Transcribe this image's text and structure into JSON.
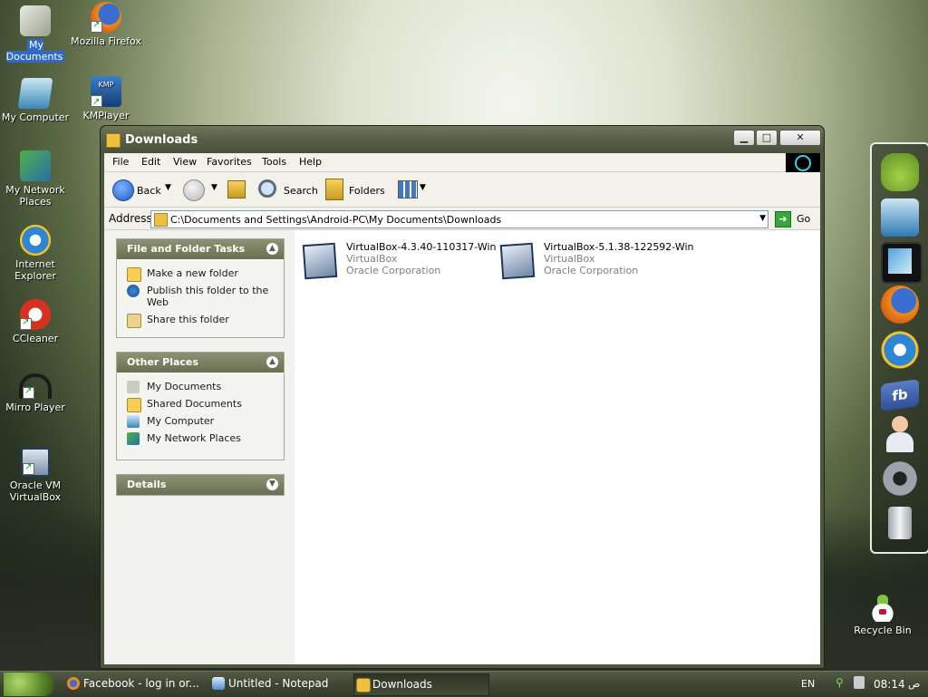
{
  "desktop": {
    "icons": [
      {
        "label": "My Documents"
      },
      {
        "label": "Mozilla Firefox"
      },
      {
        "label": "My Computer"
      },
      {
        "label": "KMPlayer",
        "badge": "KMP"
      },
      {
        "label": "My Network Places"
      },
      {
        "label": "Internet Explorer"
      },
      {
        "label": "CCleaner"
      },
      {
        "label": "Mirro Player"
      },
      {
        "label": "Oracle VM VirtualBox"
      },
      {
        "label": "Recycle Bin"
      }
    ]
  },
  "window": {
    "title": "Downloads",
    "menu": [
      "File",
      "Edit",
      "View",
      "Favorites",
      "Tools",
      "Help"
    ],
    "toolbar": {
      "back": "Back",
      "search": "Search",
      "folders": "Folders"
    },
    "address": {
      "label": "Address",
      "value": "C:\\Documents and Settings\\Android-PC\\My Documents\\Downloads",
      "go": "Go"
    },
    "tasks": {
      "file_folder": {
        "title": "File and Folder Tasks",
        "items": [
          "Make a new folder",
          "Publish this folder to the Web",
          "Share this folder"
        ]
      },
      "other_places": {
        "title": "Other Places",
        "items": [
          "My Documents",
          "Shared Documents",
          "My Computer",
          "My Network Places"
        ]
      },
      "details": {
        "title": "Details"
      }
    },
    "files": [
      {
        "name": "VirtualBox-4.3.40-110317-Win",
        "type": "VirtualBox",
        "company": "Oracle Corporation"
      },
      {
        "name": "VirtualBox-5.1.38-122592-Win",
        "type": "VirtualBox",
        "company": "Oracle Corporation"
      }
    ]
  },
  "dock": {
    "items": [
      "android-icon",
      "computer-icon",
      "tablet-icon",
      "firefox-icon",
      "ie-icon",
      "facebook-icon",
      "user-support-icon",
      "gear-icon",
      "trash-icon"
    ],
    "facebook_text": "fb"
  },
  "taskbar": {
    "items": [
      {
        "label": "Facebook - log in or..."
      },
      {
        "label": "Untitled - Notepad"
      },
      {
        "label": "Downloads"
      }
    ],
    "language": "EN",
    "time": "08:14",
    "ampm": "ص"
  },
  "colors": {
    "accent": "#316ac5",
    "title_bar": "#575e45",
    "task_header": "#697051"
  }
}
